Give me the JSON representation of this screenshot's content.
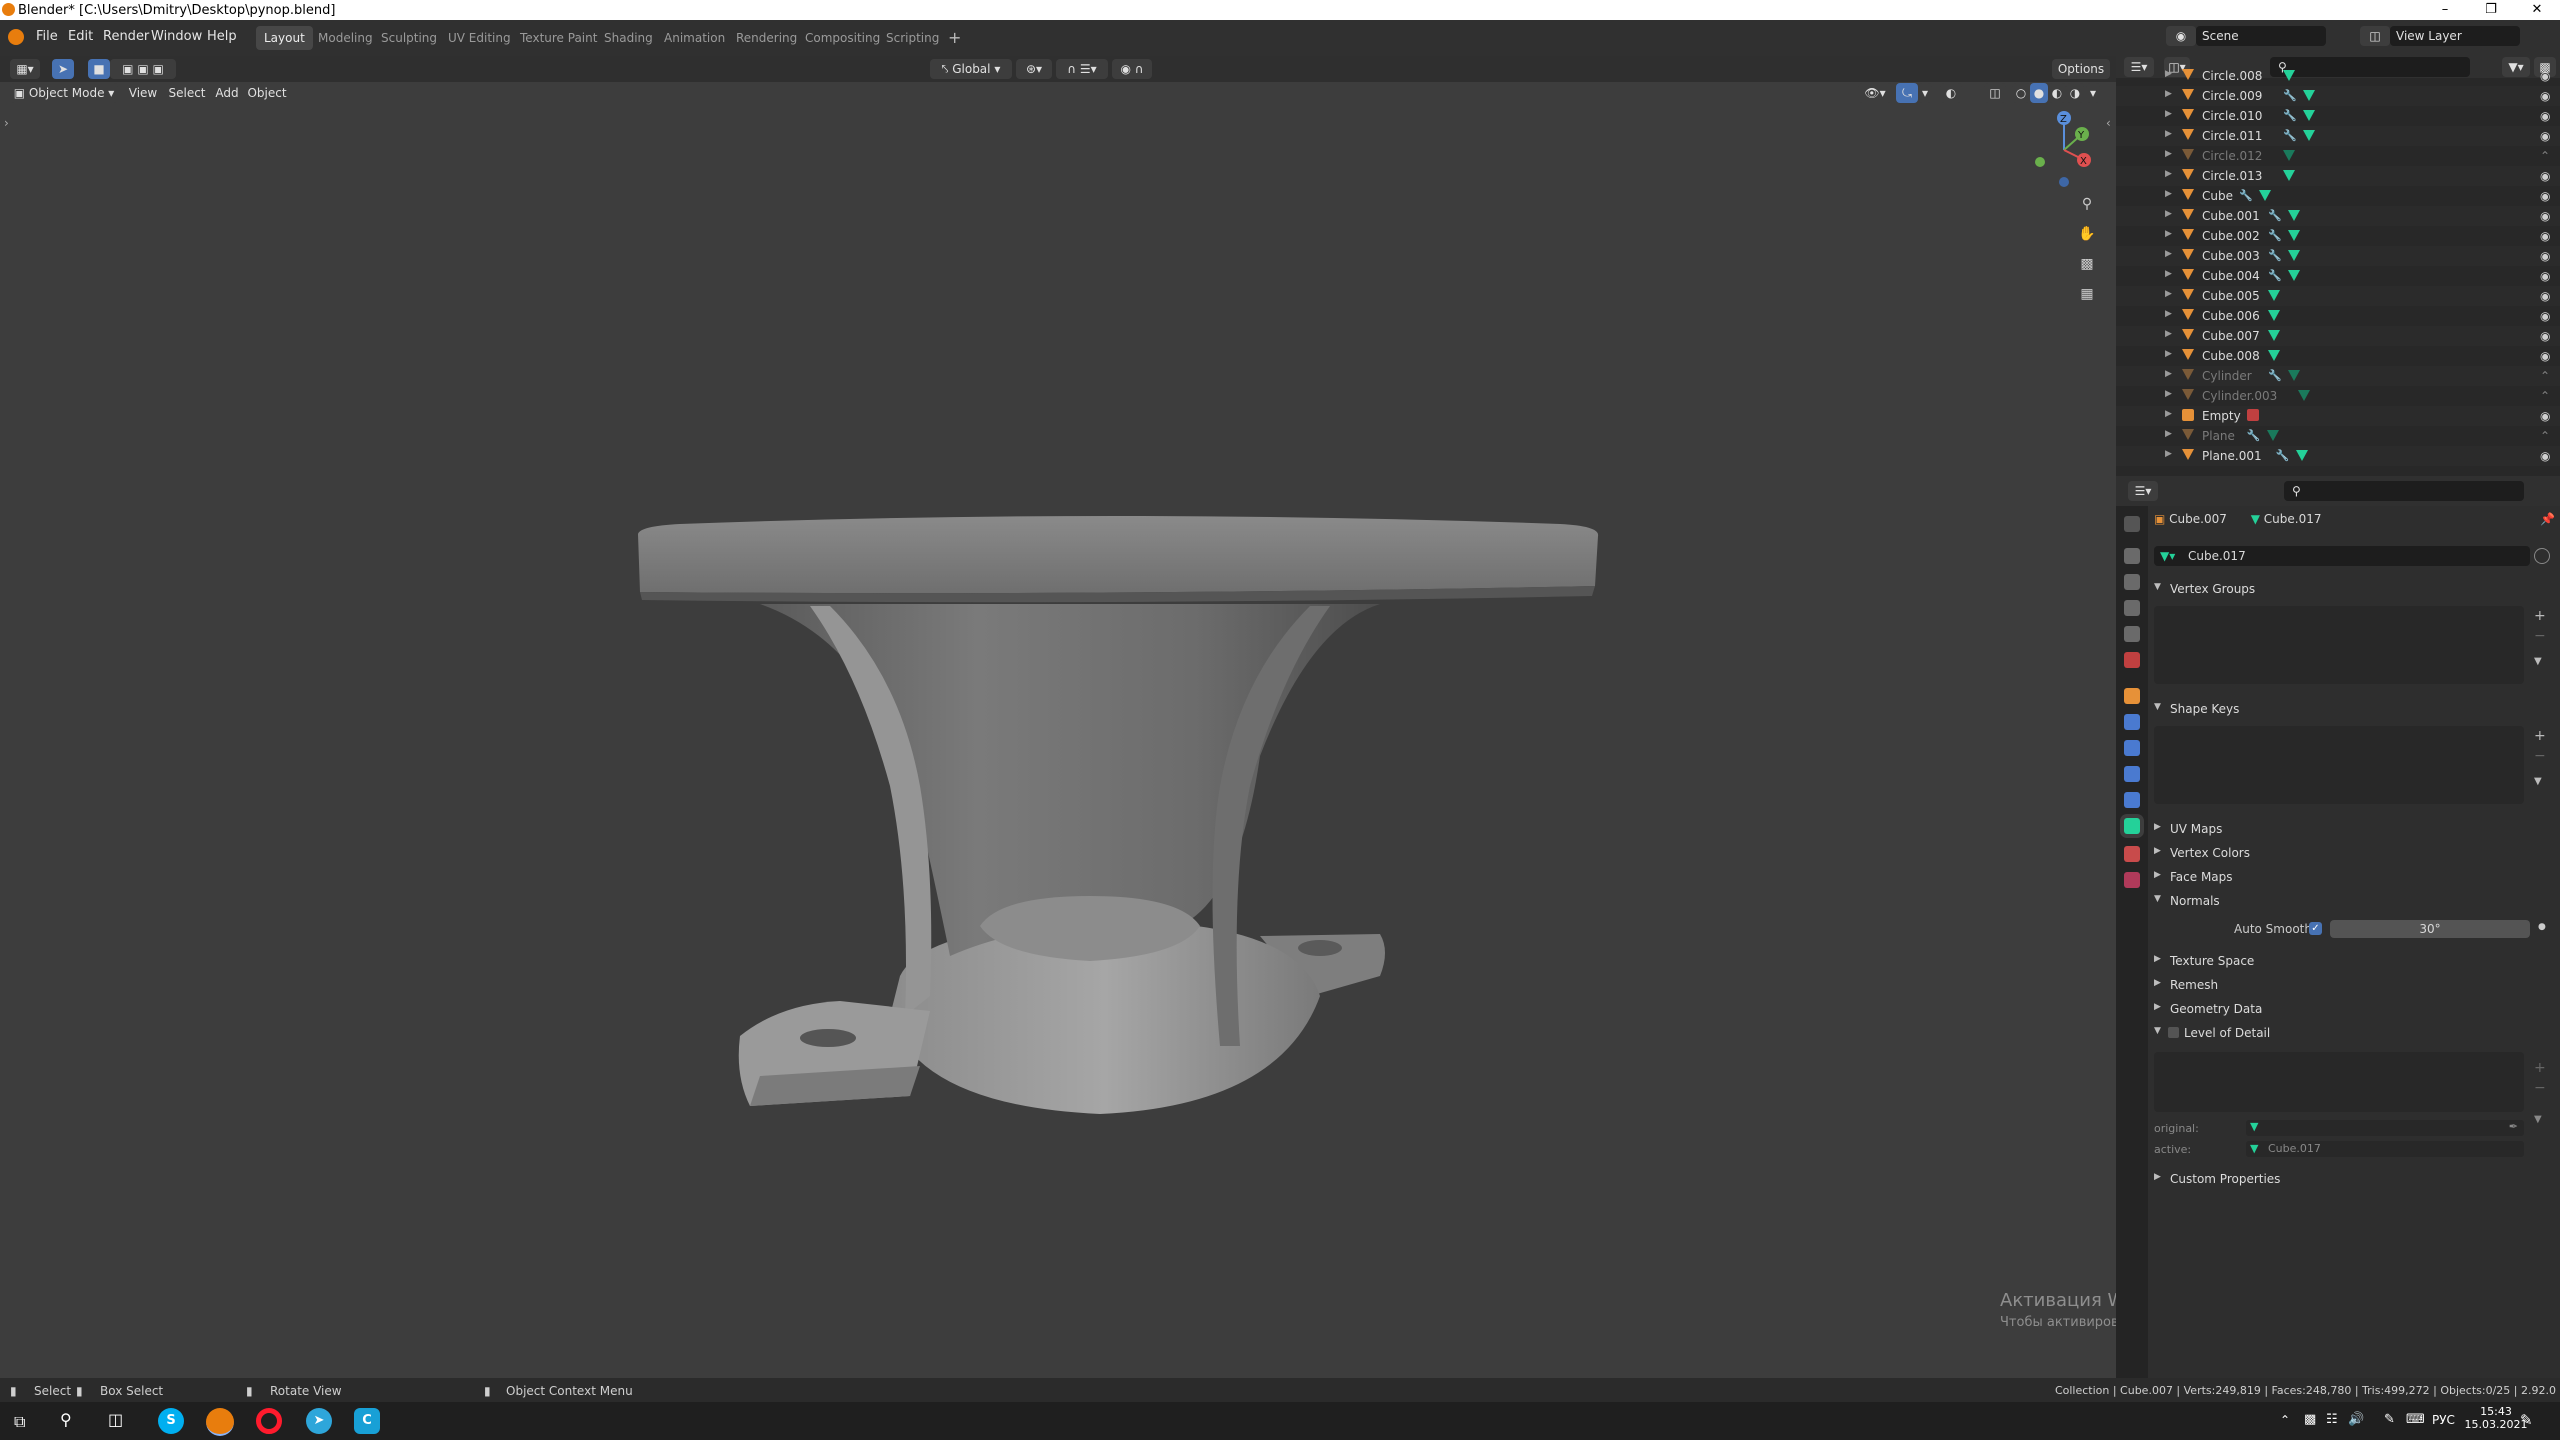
{
  "window": {
    "title": "Blender* [C:\\Users\\Dmitry\\Desktop\\pynop.blend]",
    "minimize": "–",
    "restore": "❐",
    "close": "✕"
  },
  "menu": [
    "File",
    "Edit",
    "Render",
    "Window",
    "Help"
  ],
  "workspaces": [
    "Layout",
    "Modeling",
    "Sculpting",
    "UV Editing",
    "Texture Paint",
    "Shading",
    "Animation",
    "Rendering",
    "Compositing",
    "Scripting"
  ],
  "add_workspace": "+",
  "scene": {
    "label": "Scene",
    "view_layer": "View Layer"
  },
  "viewport_header": {
    "transform_orientation": "Global",
    "options": "Options",
    "mode": "Object Mode",
    "menus": [
      "View",
      "Select",
      "Add",
      "Object"
    ]
  },
  "outliner": {
    "items": [
      {
        "name": "Circle.008",
        "mod": false,
        "dim": false
      },
      {
        "name": "Circle.009",
        "mod": true,
        "dim": false
      },
      {
        "name": "Circle.010",
        "mod": true,
        "dim": false
      },
      {
        "name": "Circle.011",
        "mod": true,
        "dim": false
      },
      {
        "name": "Circle.012",
        "mod": false,
        "dim": true
      },
      {
        "name": "Circle.013",
        "mod": false,
        "dim": false
      },
      {
        "name": "Cube",
        "mod": true,
        "dim": false
      },
      {
        "name": "Cube.001",
        "mod": true,
        "dim": false
      },
      {
        "name": "Cube.002",
        "mod": true,
        "dim": false
      },
      {
        "name": "Cube.003",
        "mod": true,
        "dim": false
      },
      {
        "name": "Cube.004",
        "mod": true,
        "dim": false
      },
      {
        "name": "Cube.005",
        "mod": false,
        "dim": false
      },
      {
        "name": "Cube.006",
        "mod": false,
        "dim": false
      },
      {
        "name": "Cube.007",
        "mod": false,
        "dim": false
      },
      {
        "name": "Cube.008",
        "mod": false,
        "dim": false
      },
      {
        "name": "Cylinder",
        "mod": true,
        "dim": true
      },
      {
        "name": "Cylinder.003",
        "mod": false,
        "dim": true
      },
      {
        "name": "Empty",
        "mod": false,
        "dim": false,
        "empty": true
      },
      {
        "name": "Plane",
        "mod": true,
        "dim": true
      },
      {
        "name": "Plane.001",
        "mod": true,
        "dim": false
      }
    ]
  },
  "properties": {
    "object_name": "Cube.007",
    "mesh_name": "Cube.017",
    "data_block": "Cube.017",
    "panels": {
      "vertex_groups": "Vertex Groups",
      "shape_keys": "Shape Keys",
      "uv_maps": "UV Maps",
      "vertex_colors": "Vertex Colors",
      "face_maps": "Face Maps",
      "normals": "Normals",
      "auto_smooth_label": "Auto Smooth",
      "auto_smooth_angle": "30°",
      "texture_space": "Texture Space",
      "remesh": "Remesh",
      "geometry_data": "Geometry Data",
      "level_of_detail": "Level of Detail",
      "original_label": "original:",
      "active_label": "active:",
      "active_value": "Cube.017",
      "custom_properties": "Custom Properties"
    }
  },
  "watermark": {
    "line1": "Активация Windows",
    "line2": "Чтобы активировать Windows, перейдите в раздел \"Параметры\"."
  },
  "status": {
    "select": "Select",
    "box_select": "Box Select",
    "rotate_view": "Rotate View",
    "context_menu": "Object Context Menu",
    "stats": "Collection | Cube.007 | Verts:249,819 | Faces:248,780 | Tris:499,272 | Objects:0/25 | 2.92.0"
  },
  "taskbar": {
    "lang": "РУС",
    "time": "15:43",
    "date": "15.03.2021"
  },
  "gizmo": {
    "z": "Z",
    "y": "Y",
    "x": "X"
  },
  "colors": {
    "accent": "#4772b3",
    "object_orange": "#e69138",
    "mesh_green": "#24d199",
    "viewport_bg": "#3d3d3d"
  }
}
